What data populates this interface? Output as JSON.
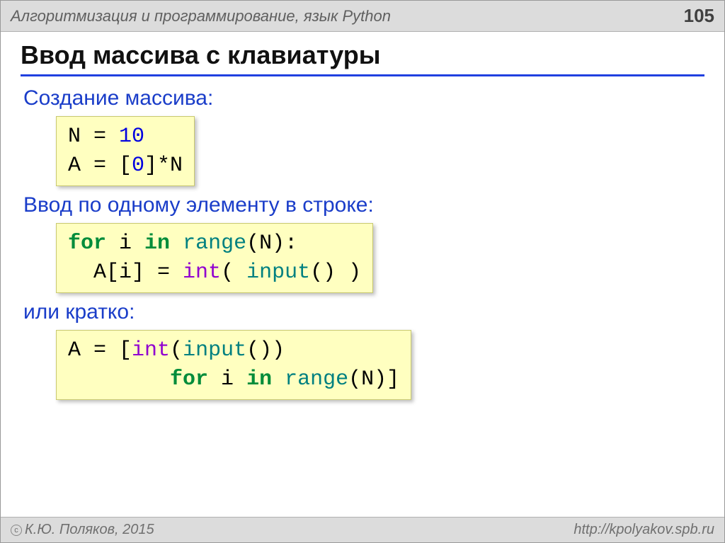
{
  "header": {
    "breadcrumb": "Алгоритмизация и программирование, язык Python",
    "page": "105"
  },
  "title": "Ввод массива с клавиатуры",
  "section1": {
    "heading": "Создание массива:",
    "code": {
      "l1_a": "N",
      "l1_eq": " = ",
      "l1_b": "10",
      "l2_a": "A",
      "l2_eq": " = [",
      "l2_b": "0",
      "l2_c": "]*N"
    }
  },
  "section2": {
    "heading": "Ввод по одному элементу в строке:",
    "code": {
      "l1_for": "for",
      "l1_mid": " i ",
      "l1_in": "in",
      "l1_sp": " ",
      "l1_range": "range",
      "l1_end": "(N):",
      "l2_a": "  A[i]",
      "l2_eq": " = ",
      "l2_int": "int",
      "l2_p1": "( ",
      "l2_input": "input",
      "l2_p2": "() )"
    }
  },
  "section3": {
    "heading": "или кратко:",
    "code": {
      "l1_a": "A",
      "l1_eq": " = [",
      "l1_int": "int",
      "l1_p1": "(",
      "l1_input": "input",
      "l1_p2": "())",
      "l2_sp": "        ",
      "l2_for": "for",
      "l2_mid": " i ",
      "l2_in": "in",
      "l2_sp2": " ",
      "l2_range": "range",
      "l2_end": "(N)]"
    }
  },
  "footer": {
    "copyright": "К.Ю. Поляков, 2015",
    "url": "http://kpolyakov.spb.ru"
  }
}
